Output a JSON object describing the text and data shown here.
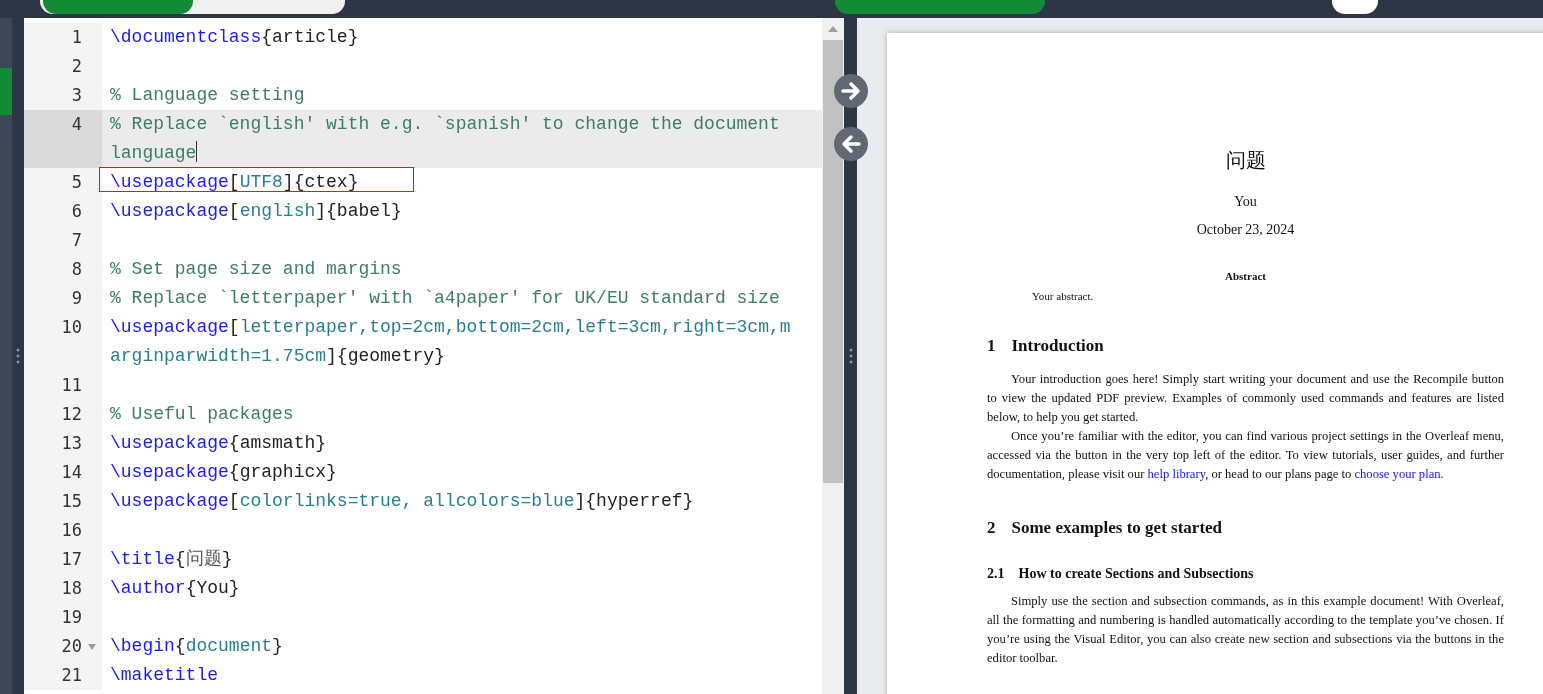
{
  "editor": {
    "lines": [
      {
        "number": "1",
        "segments": [
          {
            "kind": "command",
            "text": "\\documentclass"
          },
          {
            "kind": "plain",
            "text": "{article}"
          }
        ]
      },
      {
        "number": "2"
      },
      {
        "number": "3",
        "segments": [
          {
            "kind": "comment",
            "text": "% Language setting"
          }
        ]
      },
      {
        "number": "4",
        "active": true,
        "cursor": true,
        "segments": [
          {
            "kind": "comment",
            "text": "% Replace `english' with e.g. `spanish' to change the document language"
          }
        ]
      },
      {
        "number": "5",
        "marked": true,
        "segments": [
          {
            "kind": "command",
            "text": "\\usepackage"
          },
          {
            "kind": "plain",
            "text": "["
          },
          {
            "kind": "option",
            "text": "UTF8"
          },
          {
            "kind": "plain",
            "text": "]{ctex}"
          }
        ]
      },
      {
        "number": "6",
        "segments": [
          {
            "kind": "command",
            "text": "\\usepackage"
          },
          {
            "kind": "plain",
            "text": "["
          },
          {
            "kind": "option",
            "text": "english"
          },
          {
            "kind": "plain",
            "text": "]{babel}"
          }
        ]
      },
      {
        "number": "7"
      },
      {
        "number": "8",
        "segments": [
          {
            "kind": "comment",
            "text": "% Set page size and margins"
          }
        ]
      },
      {
        "number": "9",
        "segments": [
          {
            "kind": "comment",
            "text": "% Replace `letterpaper' with `a4paper' for UK/EU standard size"
          }
        ]
      },
      {
        "number": "10",
        "segments": [
          {
            "kind": "command",
            "text": "\\usepackage"
          },
          {
            "kind": "plain",
            "text": "["
          },
          {
            "kind": "option",
            "text": "letterpaper,top=2cm,bottom=2cm,left=3cm,right=3cm,marginparwidth=1.75cm"
          },
          {
            "kind": "plain",
            "text": "]{geometry}"
          }
        ]
      },
      {
        "number": "11"
      },
      {
        "number": "12",
        "segments": [
          {
            "kind": "comment",
            "text": "% Useful packages"
          }
        ]
      },
      {
        "number": "13",
        "segments": [
          {
            "kind": "command",
            "text": "\\usepackage"
          },
          {
            "kind": "plain",
            "text": "{amsmath}"
          }
        ]
      },
      {
        "number": "14",
        "segments": [
          {
            "kind": "command",
            "text": "\\usepackage"
          },
          {
            "kind": "plain",
            "text": "{graphicx}"
          }
        ]
      },
      {
        "number": "15",
        "segments": [
          {
            "kind": "command",
            "text": "\\usepackage"
          },
          {
            "kind": "plain",
            "text": "["
          },
          {
            "kind": "option",
            "text": "colorlinks=true, allcolors=blue"
          },
          {
            "kind": "plain",
            "text": "]{hyperref}"
          }
        ]
      },
      {
        "number": "16"
      },
      {
        "number": "17",
        "segments": [
          {
            "kind": "command",
            "text": "\\title"
          },
          {
            "kind": "plain",
            "text": "{"
          },
          {
            "kind": "cjk",
            "text": "问题"
          },
          {
            "kind": "plain",
            "text": "}"
          }
        ]
      },
      {
        "number": "18",
        "segments": [
          {
            "kind": "command",
            "text": "\\author"
          },
          {
            "kind": "plain",
            "text": "{You}"
          }
        ]
      },
      {
        "number": "19"
      },
      {
        "number": "20",
        "fold": true,
        "segments": [
          {
            "kind": "command",
            "text": "\\begin"
          },
          {
            "kind": "plain",
            "text": "{"
          },
          {
            "kind": "option",
            "text": "document"
          },
          {
            "kind": "plain",
            "text": "}"
          }
        ]
      },
      {
        "number": "21",
        "segments": [
          {
            "kind": "command",
            "text": "\\maketitle"
          }
        ]
      }
    ]
  },
  "preview": {
    "title": "问题",
    "author": "You",
    "date": "October 23, 2024",
    "abstract_heading": "Abstract",
    "abstract": "Your abstract.",
    "blocks": [
      {
        "kind": "section",
        "number": "1",
        "title": "Introduction"
      },
      {
        "kind": "paragraph",
        "parts": [
          {
            "text": "Your introduction goes here!  Simply start writing your document and use the Recompile button to view the updated PDF preview. Examples of commonly used commands and features are listed below, to help you get started."
          }
        ]
      },
      {
        "kind": "paragraph",
        "parts": [
          {
            "text": "Once you’re familiar with the editor, you can find various project settings in the Overleaf menu, accessed via the button in the very top left of the editor.  To view tutorials, user guides, and further documentation, please visit our "
          },
          {
            "text": "help library",
            "link": true
          },
          {
            "text": ", or head to our plans page to "
          },
          {
            "text": "choose your plan",
            "link": true
          },
          {
            "text": "."
          }
        ]
      },
      {
        "kind": "section",
        "number": "2",
        "title": "Some examples to get started"
      },
      {
        "kind": "subsection",
        "number": "2.1",
        "title": "How to create Sections and Subsections"
      },
      {
        "kind": "paragraph",
        "parts": [
          {
            "text": "Simply use the section and subsection commands, as in this example document! With Overleaf, all the formatting and numbering is handled automatically according to the template you’ve chosen.  If you’re using the Visual Editor, you can also create new section and subsections via the buttons in the editor toolbar."
          }
        ]
      }
    ]
  }
}
